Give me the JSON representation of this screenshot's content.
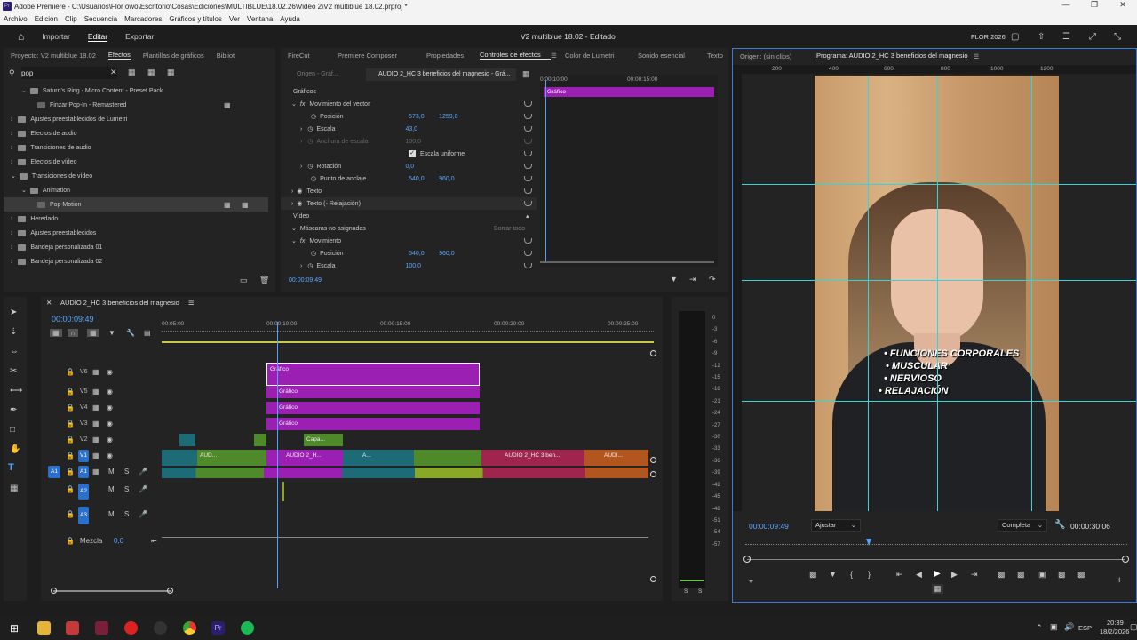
{
  "window": {
    "title": "Adobe Premiere - C:\\Usuarios\\Flor owo\\Escritorio\\Cosas\\Ediciones\\MULTIBLUE\\18.02.26\\Video 2\\V2 multiblue 18.02.prproj *",
    "logo": "Pr"
  },
  "menu": [
    "Archivo",
    "Edición",
    "Clip",
    "Secuencia",
    "Marcadores",
    "Gráficos y títulos",
    "Ver",
    "Ventana",
    "Ayuda"
  ],
  "workspace": {
    "tabs": [
      "Importar",
      "Editar",
      "Exportar"
    ],
    "project_title": "V2 multiblue 18.02 - Editado",
    "user": "FLOR 2026"
  },
  "left_panel": {
    "tabs": [
      "Proyecto: V2 multiblue 18.02",
      "Efectos",
      "Plantillas de gráficos",
      "Bibliot"
    ],
    "search": "pop",
    "items": [
      {
        "label": "Saturn's Ring - Micro Content - Preset Pack",
        "indent": 1
      },
      {
        "label": "Finzar Pop-In - Remastered",
        "indent": 2
      },
      {
        "label": "Ajustes preestablecidos de Lumetri",
        "indent": 0
      },
      {
        "label": "Efectos de audio",
        "indent": 0
      },
      {
        "label": "Transiciones de audio",
        "indent": 0
      },
      {
        "label": "Efectos de vídeo",
        "indent": 0
      },
      {
        "label": "Transiciones de vídeo",
        "indent": 0
      },
      {
        "label": "Animation",
        "indent": 1
      },
      {
        "label": "Pop Motion",
        "indent": 2
      },
      {
        "label": "Heredado",
        "indent": 0
      },
      {
        "label": "Ajustes preestablecidos",
        "indent": 0
      },
      {
        "label": "Bandeja personalizada 01",
        "indent": 0
      },
      {
        "label": "Bandeja personalizada 02",
        "indent": 0
      }
    ]
  },
  "effect_controls": {
    "tabs": [
      "FireCut",
      "Premiere Composer",
      "Propiedades",
      "Controles de efectos",
      "Color de Lumetri",
      "Sonido esencial",
      "Texto"
    ],
    "source_tab": "Origen - Gráf...",
    "sequence_tab": "AUDIO 2_HC 3 beneficios del magnesio - Grá...",
    "section_graphics": "Gráficos",
    "vector_motion": "Movimiento del vector",
    "position_label": "Posición",
    "position_x": "573,0",
    "position_y": "1259,0",
    "scale_label": "Escala",
    "scale_val": "43,0",
    "scale_width_label": "Anchura de escala",
    "scale_width_val": "100,0",
    "uniform_scale": "Escala uniforme",
    "rotation_label": "Rotación",
    "rotation_val": "0,0",
    "anchor_label": "Punto de anclaje",
    "anchor_x": "540,0",
    "anchor_y": "960,0",
    "text1": "Texto",
    "text2": "Texto (◦ Relajación)",
    "video_section": "Vídeo",
    "masks": "Máscaras no asignadas",
    "clear_all": "Borrar todo",
    "motion": "Movimiento",
    "pos2_x": "540,0",
    "pos2_y": "960,0",
    "scale2_val": "100,0",
    "timecode": "00:00:09:49",
    "ruler": [
      "0:00:10:00",
      "00:00:15:00"
    ],
    "graphic_clip": "Gráfico"
  },
  "program": {
    "tabs": [
      "Origen: (sin clips)",
      "Programa: AUDIO 2_HC 3 beneficios del magnesio"
    ],
    "ruler": [
      "200",
      "400",
      "600",
      "800",
      "1000",
      "1200"
    ],
    "overlay_lines": [
      "• FUNCIONES CORPORALES",
      "• MUSCULAR",
      "• NERVIOSO",
      "• RELAJACIÓN"
    ],
    "timecode": "00:00:09:49",
    "fit": "Ajustar",
    "quality": "Completa",
    "duration": "00:00:30:06"
  },
  "timeline": {
    "sequence": "AUDIO 2_HC 3 beneficios del magnesio",
    "timecode": "00:00:09:49",
    "ruler": [
      "00:05:00",
      "00:00:10:00",
      "00:00:15:00",
      "00:00:20:00",
      "00:00:25:00"
    ],
    "video_tracks": [
      "V6",
      "V5",
      "V4",
      "V3",
      "V2",
      "V1"
    ],
    "audio_tracks": [
      "A1",
      "A2",
      "A3"
    ],
    "mix_label": "Mezcla",
    "mix_val": "0,0",
    "clips": {
      "grafico": "Gráfico",
      "capa": "Capa...",
      "audio1": "AUD...",
      "audio2": "AUDIO 2_H...",
      "audio3": "A...",
      "audio4": "AUDIO 2_HC 3 ben...",
      "audio5": "AUDI..."
    }
  },
  "meter_scale": [
    "0",
    "-3",
    "-6",
    "-9",
    "-12",
    "-15",
    "-18",
    "-21",
    "-24",
    "-27",
    "-30",
    "-33",
    "-36",
    "-39",
    "-42",
    "-45",
    "-48",
    "-51",
    "-54",
    "-57"
  ],
  "meter_foot": [
    "S",
    "S"
  ],
  "taskbar": {
    "lang": "ESP",
    "time": "20:39",
    "date": "18/2/2026"
  },
  "colors": {
    "accent": "#3b8cff",
    "graphic_clip": "#9b1fb3",
    "video_clip": "#1d6b76",
    "audio_green": "#4e8a2a",
    "audio_pink": "#a0254e",
    "audio_orange": "#b3551f",
    "guide": "#33d6d6"
  }
}
